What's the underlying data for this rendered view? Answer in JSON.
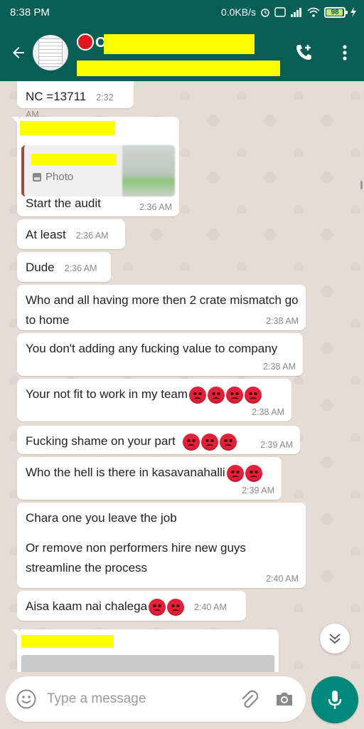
{
  "status_bar": {
    "time": "8:38 PM",
    "network_speed": "0.0KB/s",
    "battery": "98",
    "battery_level": 0.98
  },
  "header": {
    "name_visible": "O",
    "icons": [
      "back-arrow-icon",
      "voice-call-add-icon",
      "more-vert-icon"
    ]
  },
  "messages": [
    {
      "text": "NC =13711",
      "time": "2:32 AM"
    },
    {
      "quote_label": "Photo",
      "text": "Start the audit",
      "time": "2:36 AM"
    },
    {
      "text": "At least",
      "time": "2:36 AM"
    },
    {
      "text": "Dude",
      "time": "2:36 AM"
    },
    {
      "text": "Who and all having more then 2 crate mismatch go to home",
      "time": "2:38 AM"
    },
    {
      "text": "You don't adding any fucking value to company",
      "time": "2:38 AM"
    },
    {
      "text": "Your not fit to work in my team",
      "emoji_count": 4,
      "time": "2:38 AM"
    },
    {
      "text": "Fucking shame on your part",
      "emoji_count": 3,
      "time": "2:39 AM"
    },
    {
      "text": "Who the hell is there in kasavanahalli",
      "emoji_count": 2,
      "time": "2:39 AM"
    },
    {
      "text": "Chara one you leave the job",
      "text2": "Or remove non performers hire new guys streamline the process",
      "time": "2:40 AM"
    },
    {
      "text": "Aisa kaam nai chalega",
      "emoji_count": 2,
      "time": "2:40 AM"
    }
  ],
  "composer": {
    "placeholder": "Type a message"
  },
  "colors": {
    "header": "#075e54",
    "chat_bg": "#e5ddd5",
    "mic": "#00897b",
    "redaction": "#ffff00"
  }
}
